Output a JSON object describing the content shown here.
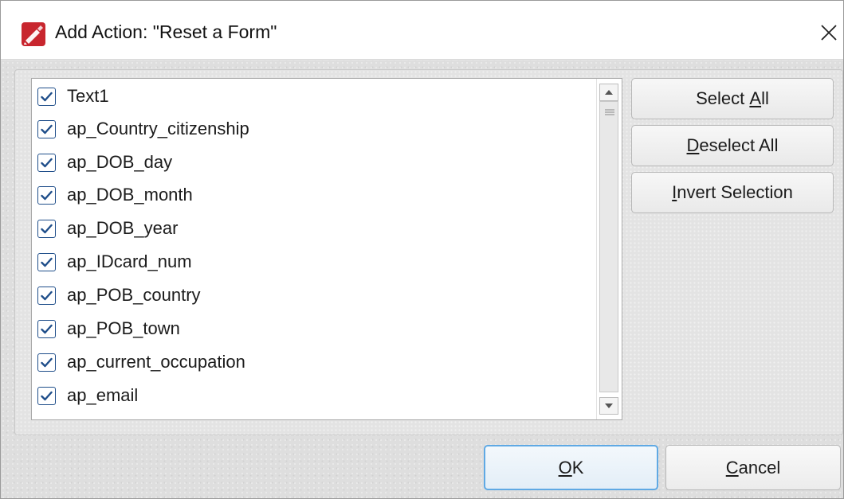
{
  "dialog": {
    "title": "Add Action: \"Reset a Form\"",
    "icon": "foxit-pdf-app-icon",
    "close_icon": "close-icon"
  },
  "fields_list": {
    "items": [
      {
        "label": "Text1",
        "checked": true
      },
      {
        "label": "ap_Country_citizenship",
        "checked": true
      },
      {
        "label": "ap_DOB_day",
        "checked": true
      },
      {
        "label": "ap_DOB_month",
        "checked": true
      },
      {
        "label": "ap_DOB_year",
        "checked": true
      },
      {
        "label": "ap_IDcard_num",
        "checked": true
      },
      {
        "label": "ap_POB_country",
        "checked": true
      },
      {
        "label": "ap_POB_town",
        "checked": true
      },
      {
        "label": "ap_current_occupation",
        "checked": true
      },
      {
        "label": "ap_email",
        "checked": true
      }
    ]
  },
  "buttons": {
    "select_all_pre": "Select ",
    "select_all_key": "A",
    "select_all_post": "ll",
    "deselect_all_key": "D",
    "deselect_all_post": "eselect All",
    "invert_key": "I",
    "invert_post": "nvert Selection",
    "ok_key": "O",
    "ok_post": "K",
    "cancel_key": "C",
    "cancel_post": "ancel"
  },
  "colors": {
    "checkbox_border": "#1f4e8a",
    "ok_focus_border": "#5fa9e4"
  }
}
